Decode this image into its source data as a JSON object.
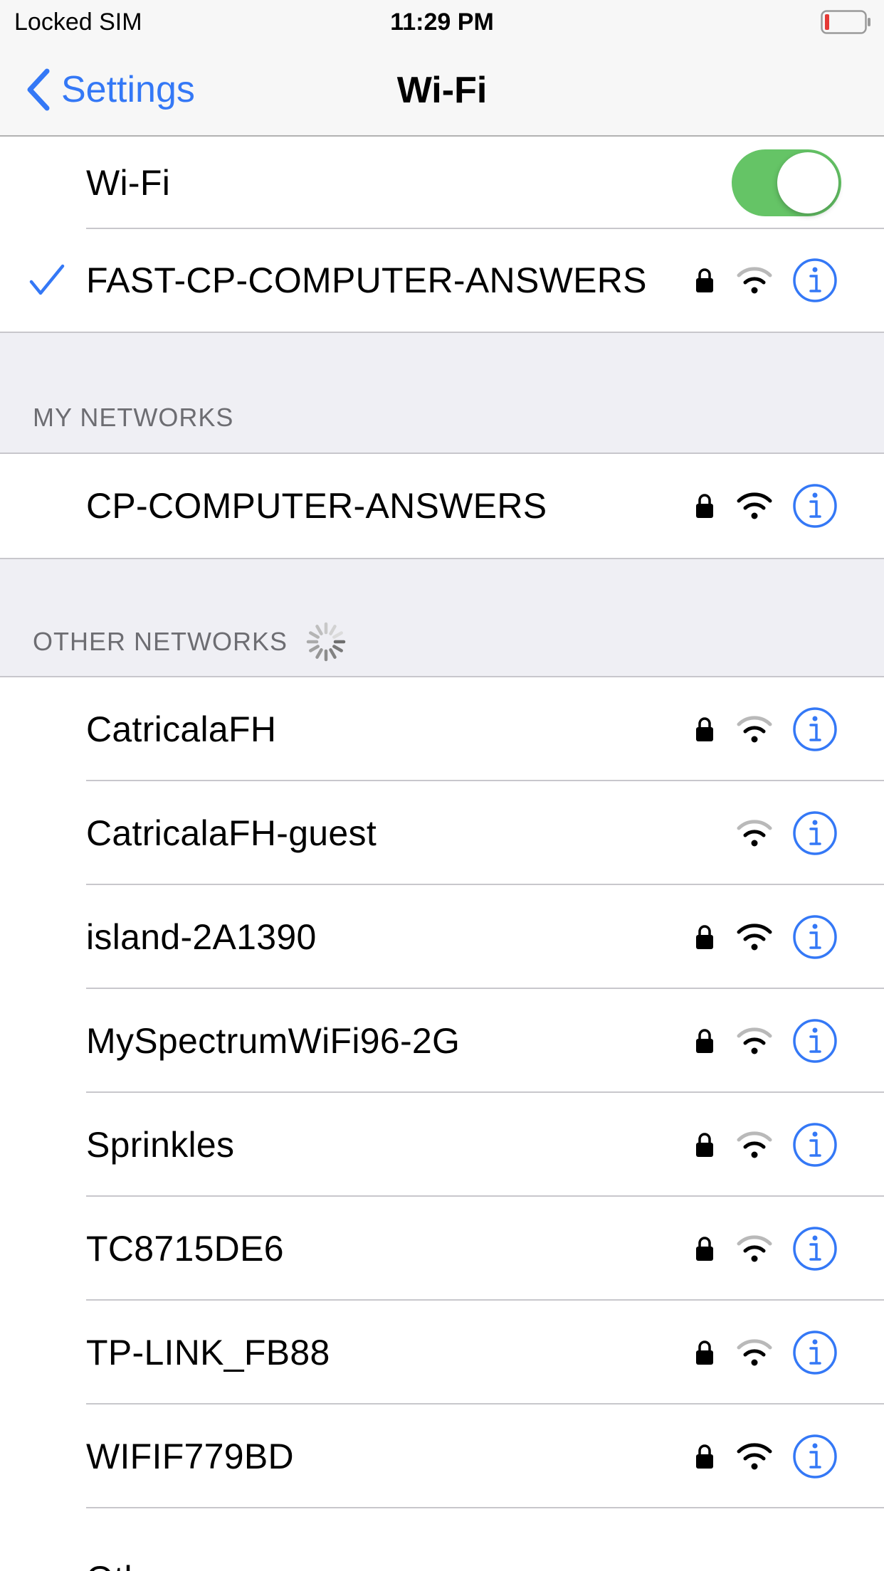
{
  "status_bar": {
    "carrier": "Locked SIM",
    "time": "11:29 PM",
    "battery_icon": "battery-low-icon"
  },
  "nav": {
    "back_label": "Settings",
    "title": "Wi-Fi"
  },
  "wifi_toggle": {
    "label": "Wi-Fi",
    "on": true
  },
  "connected": {
    "name": "FAST-CP-COMPUTER-ANSWERS",
    "secured": true,
    "signal": 2
  },
  "my_networks": {
    "header": "MY NETWORKS",
    "items": [
      {
        "name": "CP-COMPUTER-ANSWERS",
        "secured": true,
        "signal": 3
      }
    ]
  },
  "other_networks": {
    "header": "OTHER NETWORKS",
    "items": [
      {
        "name": "CatricalaFH",
        "secured": true,
        "signal": 2
      },
      {
        "name": "CatricalaFH-guest",
        "secured": false,
        "signal": 2
      },
      {
        "name": "island-2A1390",
        "secured": true,
        "signal": 3
      },
      {
        "name": "MySpectrumWiFi96-2G",
        "secured": true,
        "signal": 2
      },
      {
        "name": "Sprinkles",
        "secured": true,
        "signal": 2
      },
      {
        "name": "TC8715DE6",
        "secured": true,
        "signal": 2
      },
      {
        "name": "TP-LINK_FB88",
        "secured": true,
        "signal": 2
      },
      {
        "name": "WIFIF779BD",
        "secured": true,
        "signal": 3
      }
    ],
    "other_label": "Other..."
  },
  "colors": {
    "accent": "#3478f6",
    "toggle_on": "#65c466",
    "battery_low": "#e53935"
  }
}
